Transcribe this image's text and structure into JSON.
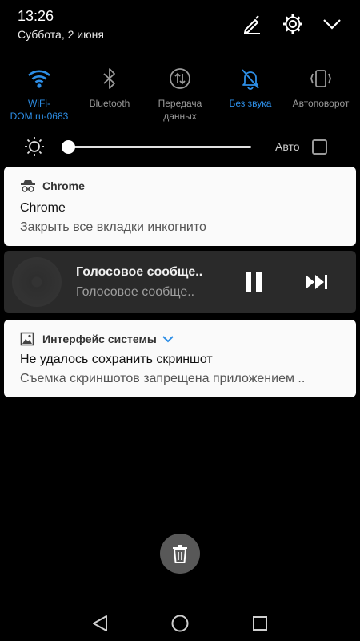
{
  "status": {
    "time": "13:26",
    "date": "Суббота, 2 июня"
  },
  "header_icons": [
    "edit-icon",
    "gear-icon",
    "chevron-down-icon"
  ],
  "toggles": [
    {
      "label": "WiFi-\nDOM.ru-0683",
      "icon": "wifi-icon",
      "active": true
    },
    {
      "label": "Bluetooth",
      "icon": "bluetooth-icon",
      "active": false
    },
    {
      "label": "Передача\nданных",
      "icon": "data-transfer-icon",
      "active": false
    },
    {
      "label": "Без звука",
      "icon": "mute-icon",
      "active": true
    },
    {
      "label": "Автоповорот",
      "icon": "autorotate-icon",
      "active": false
    }
  ],
  "brightness": {
    "level": 0.0,
    "auto_label": "Авто",
    "auto_checked": false
  },
  "notifications": {
    "chrome": {
      "app": "Chrome",
      "title": "Chrome",
      "text": "Закрыть все вкладки инкогнито"
    },
    "media": {
      "title": "Голосовое сообще..",
      "subtitle": "Голосовое сообще.."
    },
    "system": {
      "app": "Интерфейс системы",
      "title": "Не удалось сохранить скриншот",
      "text": "Съемка скриншотов запрещена приложением .."
    }
  },
  "colors": {
    "accent": "#2d8ee6",
    "inactive": "#9a9a9a",
    "card": "#fafafa",
    "media_bg": "#2a2a2a"
  }
}
